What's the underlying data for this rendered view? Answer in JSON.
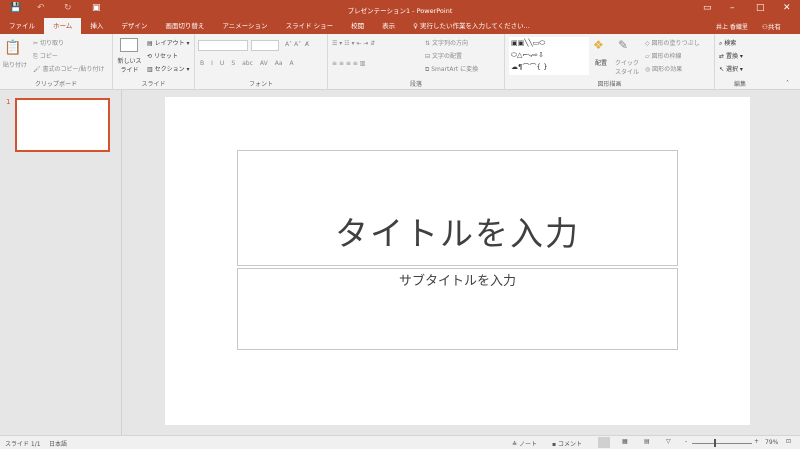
{
  "window": {
    "title": "プレゼンテーション1 - PowerPoint",
    "user": "井上 香織里",
    "share": "共有"
  },
  "quick_access": [
    "save-icon",
    "undo-icon",
    "redo-icon",
    "start-from-beginning-icon"
  ],
  "tabs": [
    "ファイル",
    "ホーム",
    "挿入",
    "デザイン",
    "画面切り替え",
    "アニメーション",
    "スライド ショー",
    "校閲",
    "表示"
  ],
  "active_tab": "ホーム",
  "tell_me": "実行したい作業を入力してください...",
  "ribbon": {
    "clipboard": {
      "label": "クリップボード",
      "paste": "貼り付け",
      "cut": "切り取り",
      "copy": "コピー",
      "format_painter": "書式のコピー/貼り付け"
    },
    "slides": {
      "label": "スライド",
      "new_slide": "新しいスライド",
      "layout": "レイアウト",
      "reset": "リセット",
      "section": "セクション"
    },
    "font": {
      "label": "フォント",
      "buttons": [
        "B",
        "I",
        "U",
        "S",
        "abc",
        "AV",
        "Aa",
        "A"
      ]
    },
    "paragraph": {
      "label": "段落",
      "text_direction": "文字列の方向",
      "align_text": "文字の配置",
      "smartart": "SmartArt に変換"
    },
    "drawing": {
      "label": "図形描画",
      "arrange": "配置",
      "quick_styles": "クイック スタイル",
      "shape_fill": "図形の塗りつぶし",
      "shape_outline": "図形の枠線",
      "shape_effects": "図形の効果"
    },
    "editing": {
      "label": "編集",
      "find": "検索",
      "replace": "置換",
      "select": "選択"
    }
  },
  "thumbnails": [
    {
      "number": "1"
    }
  ],
  "slide": {
    "title_placeholder": "タイトルを入力",
    "subtitle_placeholder": "サブタイトルを入力"
  },
  "status": {
    "slide": "スライド 1/1",
    "language": "日本語",
    "notes": "ノート",
    "comments": "コメント",
    "zoom": "79%",
    "zoom_value": 79
  },
  "colors": {
    "accent": "#b7472a"
  }
}
